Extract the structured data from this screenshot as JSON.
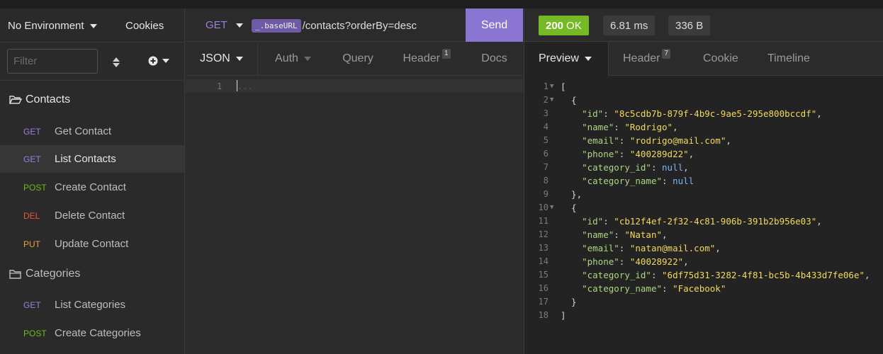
{
  "sidebar": {
    "environment": "No Environment",
    "cookies": "Cookies",
    "filter_placeholder": "Filter",
    "folders": [
      {
        "name": "Contacts",
        "requests": [
          {
            "method": "GET",
            "name": "Get Contact"
          },
          {
            "method": "GET",
            "name": "List Contacts"
          },
          {
            "method": "POST",
            "name": "Create Contact"
          },
          {
            "method": "DEL",
            "name": "Delete Contact"
          },
          {
            "method": "PUT",
            "name": "Update Contact"
          }
        ]
      },
      {
        "name": "Categories",
        "requests": [
          {
            "method": "GET",
            "name": "List Categories"
          },
          {
            "method": "POST",
            "name": "Create Categories"
          }
        ]
      }
    ]
  },
  "request": {
    "method": "GET",
    "base_var": "_.baseURL",
    "path": "/contacts?orderBy=desc",
    "send": "Send",
    "tabs": [
      {
        "label": "JSON",
        "badge": ""
      },
      {
        "label": "Auth",
        "badge": ""
      },
      {
        "label": "Query",
        "badge": ""
      },
      {
        "label": "Header",
        "badge": "1"
      },
      {
        "label": "Docs",
        "badge": ""
      }
    ],
    "body_line_number": "1",
    "body_placeholder": "..."
  },
  "response": {
    "status_code": "200",
    "status_text": "OK",
    "time": "6.81 ms",
    "size": "336 B",
    "tabs": [
      {
        "label": "Preview",
        "badge": ""
      },
      {
        "label": "Header",
        "badge": "7"
      },
      {
        "label": "Cookie",
        "badge": ""
      },
      {
        "label": "Timeline",
        "badge": ""
      }
    ],
    "contacts": [
      {
        "id": "8c5cdb7b-879f-4b9c-9ae5-295e800bccdf",
        "name": "Rodrigo",
        "email": "rodrigo@mail.com",
        "phone": "400289d22",
        "category_id": "null",
        "category_name": "null"
      },
      {
        "id": "cb12f4ef-2f32-4c81-906b-391b2b956e03",
        "name": "Natan",
        "email": "natan@mail.com",
        "phone": "40028922",
        "category_id": "6df75d31-3282-4f81-bc5b-4b433d7fe06e",
        "category_name": "Facebook"
      }
    ]
  },
  "colors": {
    "get": "#9f7fe2",
    "post": "#74b816",
    "del": "#e8543e",
    "put": "#e7a03a",
    "accent": "#8b75d3",
    "ok": "#75ba24"
  },
  "icons": [
    "folder-open-icon",
    "folder-icon",
    "sort-icon",
    "plus-circle-icon",
    "chevron-down-icon"
  ]
}
